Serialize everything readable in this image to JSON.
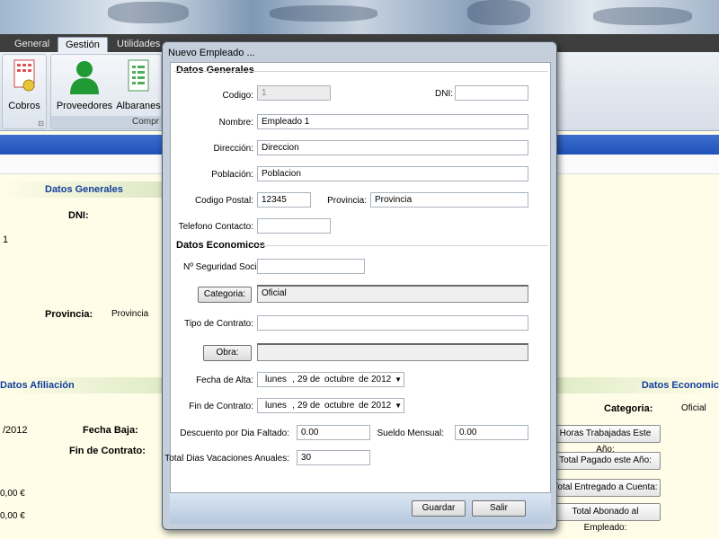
{
  "ribbon": {
    "tabs": [
      "General",
      "Gestión",
      "Utilidades"
    ],
    "buttons": {
      "cobros": "Cobros",
      "proveedores": "Proveedores",
      "albaranes": "Albaranes"
    },
    "group_caption": "Compr"
  },
  "background": {
    "datos_generales": "Datos Generales",
    "dni_label": "DNI:",
    "value_one": "1",
    "provincia_label": "Provincia:",
    "provincia_value": "Provincia",
    "datos_afiliacion": "Datos Afiliación",
    "datos_economicos": "Datos Economic",
    "date_fragment": "/2012",
    "fecha_baja_label": "Fecha Baja:",
    "fin_contrato_label": "Fin de Contrato:",
    "categoria_label": "Categoria:",
    "categoria_value": "Oficial",
    "money1": "0,00 €",
    "money2": "0,00 €",
    "btn_horas": "Horas Trabajadas Este Año:",
    "btn_pagado": "Total Pagado este Año:",
    "btn_entregado": "Total Entregado a Cuenta:",
    "btn_abonado": "Total Abonado al Empleado:"
  },
  "dialog": {
    "title": "Nuevo Empleado ...",
    "section_generales": "Datos Generales",
    "section_economicos": "Datos Economicos",
    "fields": {
      "codigo_label": "Codigo:",
      "codigo_value": "1",
      "dni_label": "DNI:",
      "dni_value": "",
      "nombre_label": "Nombre:",
      "nombre_value": "Empleado 1",
      "direccion_label": "Dirección:",
      "direccion_value": "Direccion",
      "poblacion_label": "Población:",
      "poblacion_value": "Poblacion",
      "cp_label": "Codigo Postal:",
      "cp_value": "12345",
      "provincia_label": "Provincia:",
      "provincia_value": "Provincia",
      "telefono_label": "Telefono Contacto:",
      "telefono_value": "",
      "nss_label": "Nº Seguridad Social:",
      "nss_value": "",
      "categoria_button": "Categoria:",
      "categoria_value": "Oficial",
      "tipo_contrato_label": "Tipo de Contrato:",
      "tipo_contrato_value": "",
      "obra_button": "Obra:",
      "obra_value": "",
      "fecha_alta_label": "Fecha de Alta:",
      "fin_contrato_label": "Fin de Contrato:",
      "descuento_label": "Descuento por Dia Faltado:",
      "descuento_value": "0.00",
      "sueldo_label": "Sueldo Mensual:",
      "sueldo_value": "0.00",
      "vacaciones_label": "Total Dias Vacaciones Anuales:",
      "vacaciones_value": "30"
    },
    "fecha_alta": {
      "weekday": "lunes",
      "day": "29",
      "de1": "de",
      "month": "octubre",
      "de2": "de",
      "year": "2012"
    },
    "fin_contrato": {
      "weekday": "lunes",
      "day": "29",
      "de1": "de",
      "month": "octubre",
      "de2": "de",
      "year": "2012"
    },
    "buttons": {
      "guardar": "Guardar",
      "salir": "Salir"
    }
  }
}
